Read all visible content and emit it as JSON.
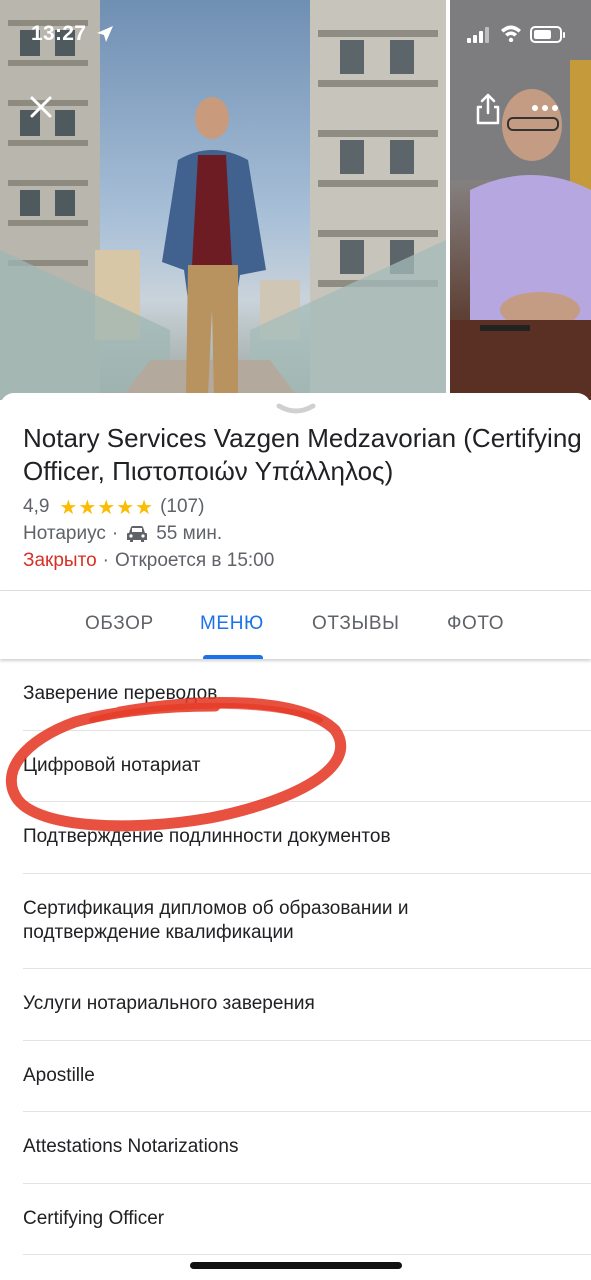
{
  "status_bar": {
    "time": "13:27"
  },
  "icons": {
    "close": "close-icon",
    "share": "share-icon",
    "more": "more-horizontal-icon",
    "car": "car-icon",
    "location": "location-arrow-icon"
  },
  "place": {
    "title": "Notary Services Vazgen Medzavorian (Certifying Officer, Πιστοποιών Υπάλληλος)",
    "rating": "4,9",
    "stars": "★★★★★",
    "reviews": "(107)",
    "category": "Нотариус",
    "drive_time": "55 мин.",
    "status": "Закрыто",
    "opens": "Откроется в 15:00"
  },
  "tabs": [
    "ОБЗОР",
    "МЕНЮ",
    "ОТЗЫВЫ",
    "ФОТО"
  ],
  "active_tab": "МЕНЮ",
  "menu_items": [
    "Заверение переводов",
    "Цифровой нотариат",
    "Подтверждение подлинности документов",
    "Сертификация дипломов об образовании и подтверждение квалификации",
    "Услуги нотариального заверения",
    "Apostille",
    "Attestations Notarizations",
    "Certifying Officer"
  ],
  "colors": {
    "accent": "#1a73e8",
    "closed": "#d93025",
    "stars": "#fbbc04",
    "annotation": "#e53925"
  }
}
